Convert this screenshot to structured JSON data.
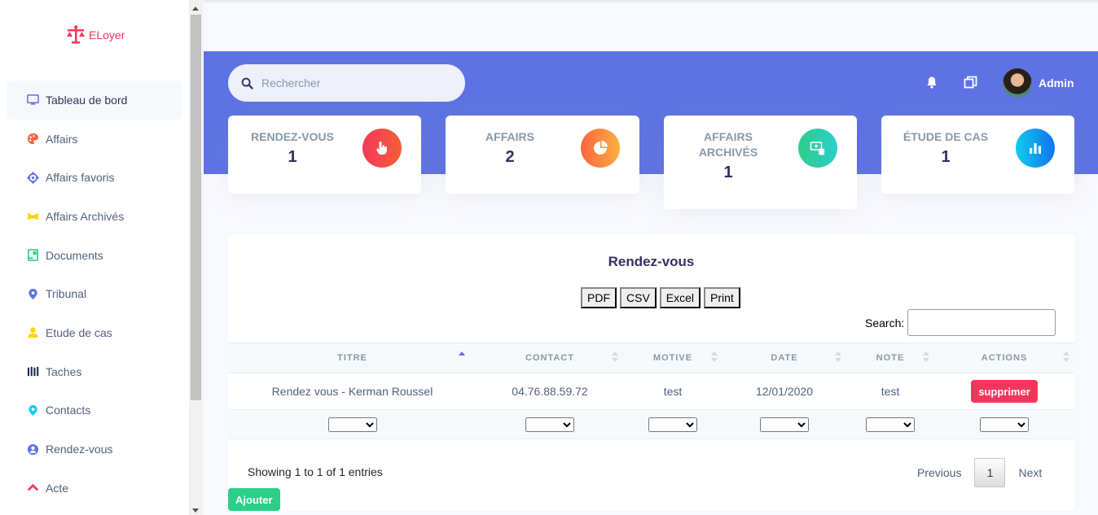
{
  "brand": {
    "name": "ELoyer"
  },
  "sidebar": {
    "items": [
      {
        "label": "Tableau de bord",
        "icon": "monitor-icon",
        "color": "#5e72e4"
      },
      {
        "label": "Affairs",
        "icon": "palette-icon",
        "color": "#fb6340"
      },
      {
        "label": "Affairs favoris",
        "icon": "planet-icon",
        "color": "#5e72e4"
      },
      {
        "label": "Affairs Archivés",
        "icon": "ribbon-icon",
        "color": "#ffd600"
      },
      {
        "label": "Documents",
        "icon": "document-icon",
        "color": "#2dce89"
      },
      {
        "label": "Tribunal",
        "icon": "pin-icon",
        "color": "#5e72e4"
      },
      {
        "label": "Etude de cas",
        "icon": "user-icon",
        "color": "#ffd600"
      },
      {
        "label": "Taches",
        "icon": "bullet-list-icon",
        "color": "#172b4d"
      },
      {
        "label": "Contacts",
        "icon": "map-pin-icon",
        "color": "#11cdef"
      },
      {
        "label": "Rendez-vous",
        "icon": "circle-user-icon",
        "color": "#5e72e4"
      },
      {
        "label": "Acte",
        "icon": "chevron-up-icon",
        "color": "#f5365c"
      }
    ]
  },
  "header": {
    "search_placeholder": "Rechercher",
    "user_name": "Admin"
  },
  "stats": [
    {
      "label": "RENDEZ-VOUS",
      "value": "1",
      "icon": "hand-pointer-icon",
      "color": "#f5365c"
    },
    {
      "label": "AFFAIRS",
      "value": "2",
      "icon": "pie-chart-icon",
      "color": "#fb6340"
    },
    {
      "label": "AFFAIRS ARCHIVÉS",
      "value": "1",
      "icon": "money-coins-icon",
      "color": "#2dce89"
    },
    {
      "label": "ÉTUDE DE CAS",
      "value": "1",
      "icon": "bar-chart-icon",
      "color": "#11cdef"
    }
  ],
  "table_panel": {
    "title": "Rendez-vous",
    "export_buttons": [
      "PDF",
      "CSV",
      "Excel",
      "Print"
    ],
    "search_label": "Search:",
    "columns": [
      "TITRE",
      "CONTACT",
      "MOTIVE",
      "DATE",
      "NOTE",
      "ACTIONS"
    ],
    "rows": [
      {
        "titre": "Rendez vous - Kerman Roussel",
        "contact": "04.76.88.59.72",
        "motive": "test",
        "date": "12/01/2020",
        "note": "test",
        "action": "supprimer"
      }
    ],
    "info": "Showing 1 to 1 of 1 entries",
    "pager": {
      "previous": "Previous",
      "current": "1",
      "next": "Next"
    }
  },
  "add_button": "Ajouter"
}
